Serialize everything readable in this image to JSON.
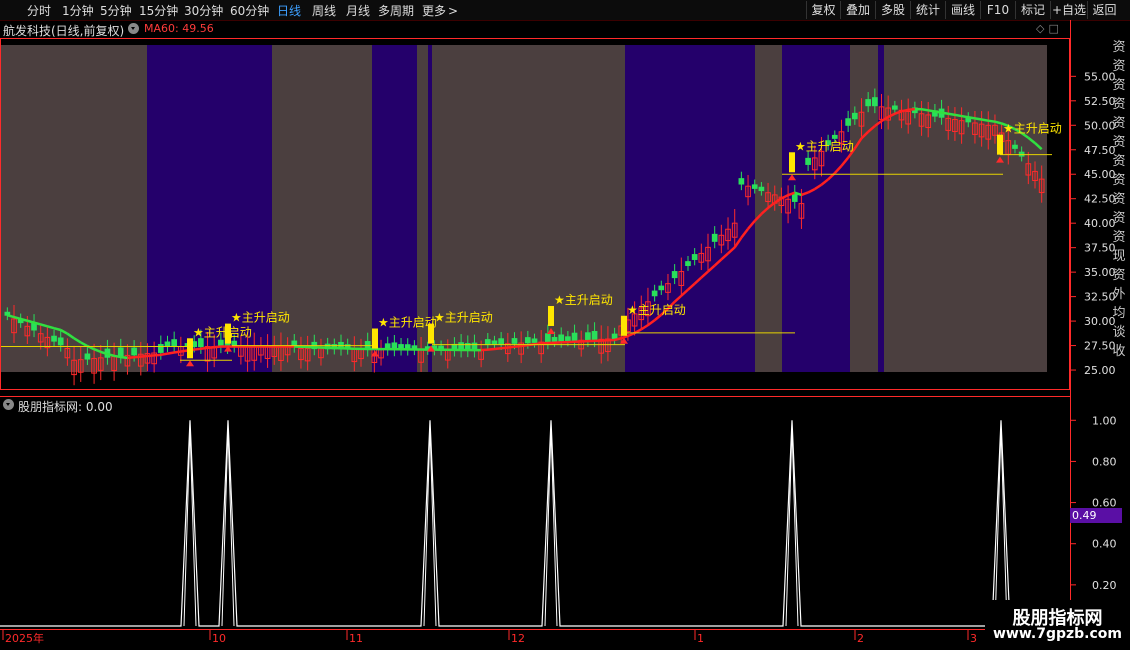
{
  "toolbar": {
    "periods": [
      "分时",
      "1分钟",
      "5分钟",
      "15分钟",
      "30分钟",
      "60分钟",
      "日线",
      "周线",
      "月线",
      "多周期",
      "更多"
    ],
    "more_arrow": ">",
    "active_period": "日线",
    "right_buttons": [
      "复权",
      "叠加",
      "多股",
      "统计",
      "画线",
      "F10",
      "标记",
      "+自选",
      "返回"
    ]
  },
  "chart_header": {
    "stock": "航发科技(日线,前复权)",
    "ma_label": "MA60: 49.56"
  },
  "indicator": {
    "name": "股朋指标网",
    "value": ": 0.00",
    "current_value": "0.49"
  },
  "signal_label": "★主升启动",
  "right_strip_chars": [
    "资",
    "资",
    "资",
    "资",
    "资",
    "资",
    "资",
    "资",
    "资",
    "资",
    "资",
    "现",
    "资",
    "外",
    "均",
    "谈",
    "收"
  ],
  "x_axis_labels": [
    "2025年",
    "10",
    "11",
    "12",
    "1",
    "2",
    "3"
  ],
  "watermark": {
    "title": "股朋指标网",
    "url": "www.7gpzb.com"
  },
  "colors": {
    "up": "#ff2a2a",
    "down": "#29e05a",
    "ma_up": "#ff2020",
    "ma_down": "#30e040",
    "ma_low": "#2040ff",
    "band_a": "#4b3f3f",
    "band_b": "#24006b",
    "signal_bar": "#ffe600",
    "support_line": "#e6d300",
    "axis": "#ff2a2a",
    "indicator_line": "#ffffff",
    "indicator_badge": "#5a0fa5"
  },
  "chart_data": [
    {
      "type": "candlestick",
      "title": "航发科技(日线,前复权)",
      "y_ticks": [
        25.0,
        27.5,
        30.0,
        32.5,
        35.0,
        37.5,
        40.0,
        42.5,
        45.0,
        47.5,
        50.0,
        52.5,
        55.0
      ],
      "ylim": [
        24.8,
        58.2
      ],
      "x_labels": [
        "2025年",
        "10",
        "11",
        "12",
        "1",
        "2",
        "3"
      ],
      "ma60_last": 49.56,
      "series": [
        {
          "name": "MA60",
          "last_value": 49.56
        }
      ],
      "signals": [
        {
          "label": "★主升启动",
          "price_level": 26.2
        },
        {
          "label": "★主升启动",
          "price_level": 27.7
        },
        {
          "label": "★主升启动",
          "price_level": 27.2
        },
        {
          "label": "★主升启动",
          "price_level": 27.7
        },
        {
          "label": "★主升启动",
          "price_level": 29.5
        },
        {
          "label": "★主升启动",
          "price_level": 28.5
        },
        {
          "label": "★主升启动",
          "price_level": 45.2
        },
        {
          "label": "★主升启动",
          "price_level": 47.0
        }
      ]
    },
    {
      "type": "line",
      "title": "股朋指标网",
      "y_ticks": [
        0.2,
        0.4,
        0.6,
        0.8,
        1.0
      ],
      "ylim": [
        0,
        1.05
      ],
      "current_value": 0.49,
      "spikes": [
        1,
        1,
        1,
        1,
        1,
        1
      ]
    }
  ]
}
